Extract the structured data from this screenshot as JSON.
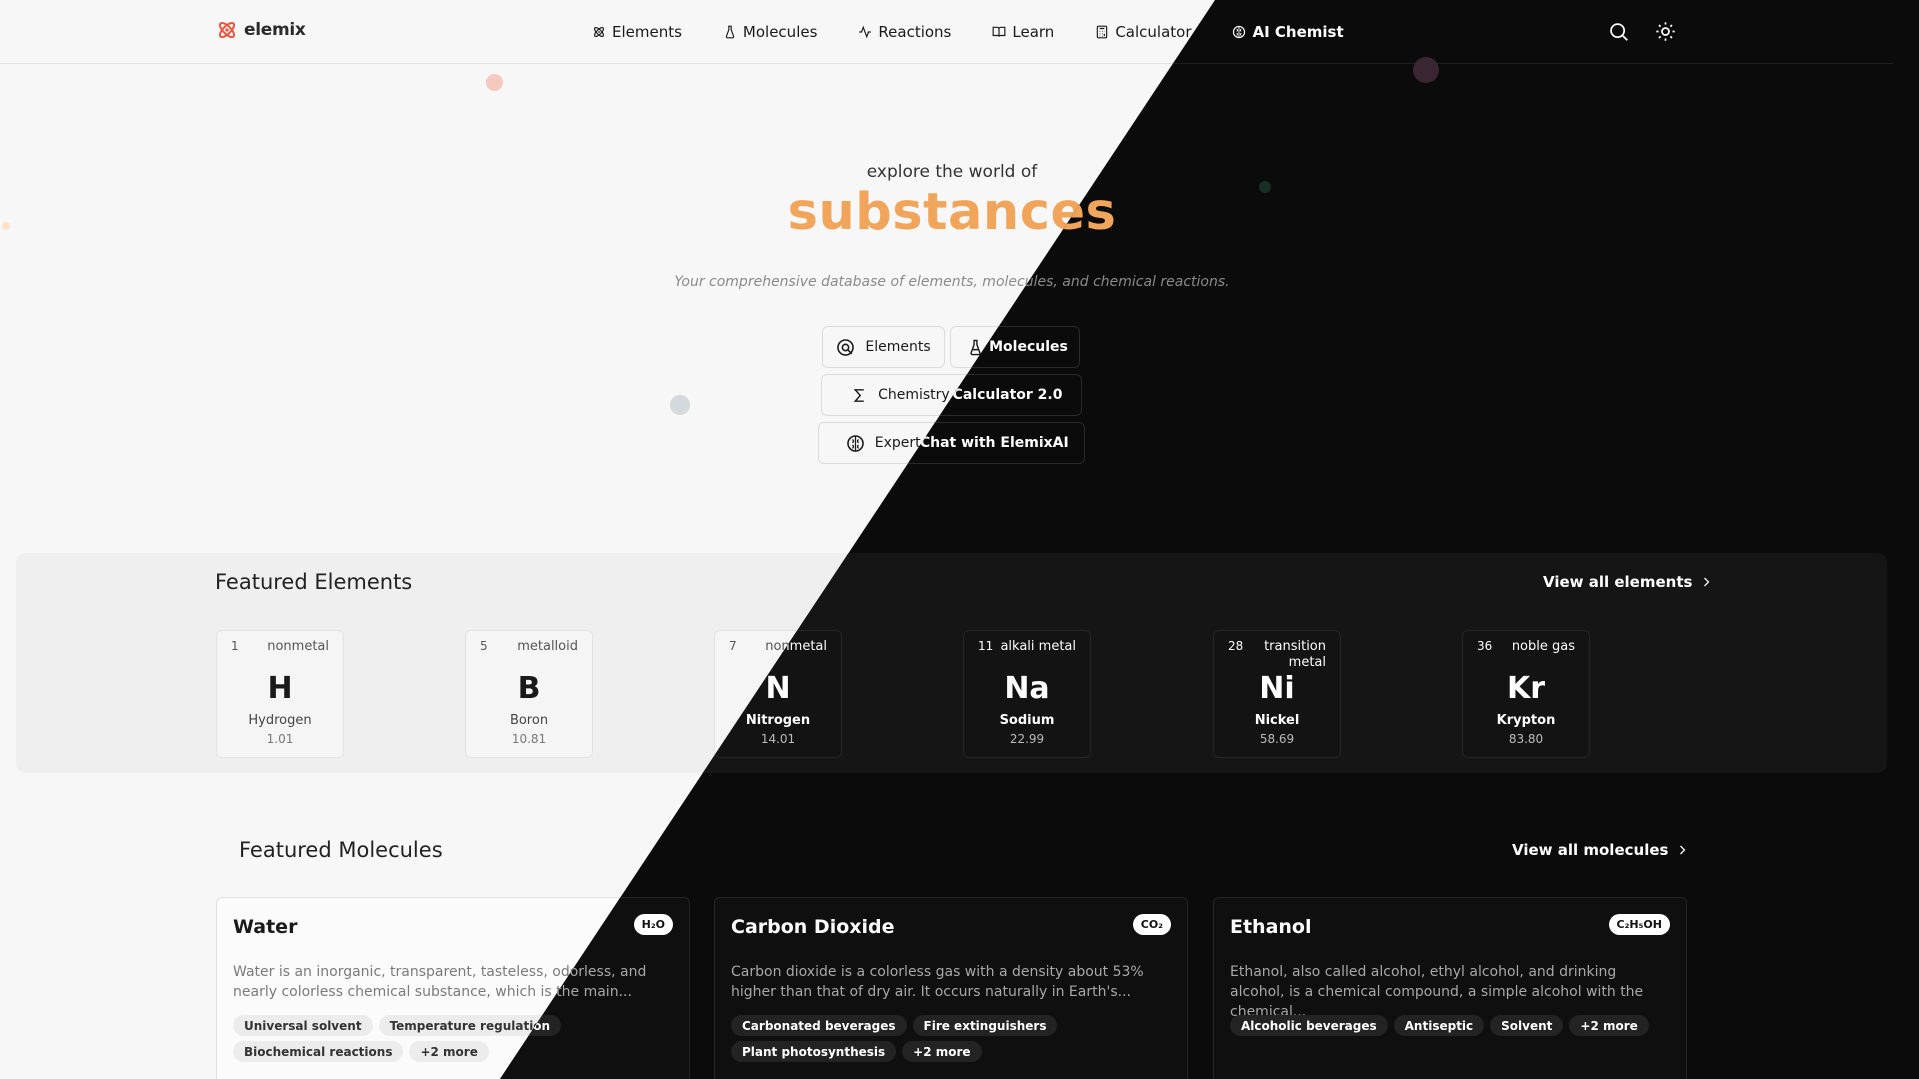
{
  "brand": {
    "name": "elemix"
  },
  "nav": {
    "links": [
      {
        "label": "Elements",
        "icon": "atom-icon"
      },
      {
        "label": "Molecules",
        "icon": "flask-icon"
      },
      {
        "label": "Reactions",
        "icon": "activity-icon"
      },
      {
        "label": "Learn",
        "icon": "book-icon"
      },
      {
        "label": "Calculator",
        "icon": "calculator-icon"
      },
      {
        "label": "AI Chemist",
        "icon": "brain-icon"
      }
    ],
    "tools": [
      "search-icon",
      "sun-icon"
    ]
  },
  "hero": {
    "kicker": "explore the world of",
    "title": "substances",
    "subtitle": "Your comprehensive database of elements, molecules, and chemical reactions.",
    "buttons": {
      "elements": "Elements",
      "molecules": "Molecules",
      "calculator": "Chemistry Calculator 2.0",
      "chat": "Expert Chat with ElemixAI"
    }
  },
  "featured_elements": {
    "title": "Featured Elements",
    "view_all": "View all elements",
    "items": [
      {
        "number": "1",
        "category": "nonmetal",
        "symbol": "H",
        "name": "Hydrogen",
        "mass": "1.01"
      },
      {
        "number": "5",
        "category": "metalloid",
        "symbol": "B",
        "name": "Boron",
        "mass": "10.81"
      },
      {
        "number": "7",
        "category": "nonmetal",
        "symbol": "N",
        "name": "Nitrogen",
        "mass": "14.01"
      },
      {
        "number": "11",
        "category": "alkali metal",
        "symbol": "Na",
        "name": "Sodium",
        "mass": "22.99"
      },
      {
        "number": "28",
        "category": "transition metal",
        "symbol": "Ni",
        "name": "Nickel",
        "mass": "58.69"
      },
      {
        "number": "36",
        "category": "noble gas",
        "symbol": "Kr",
        "name": "Krypton",
        "mass": "83.80"
      }
    ]
  },
  "featured_molecules": {
    "title": "Featured Molecules",
    "view_all": "View all molecules",
    "items": [
      {
        "name": "Water",
        "formula": "H₂O",
        "description": "Water is an inorganic, transparent, tasteless, odorless, and nearly colorless chemical substance, which is the main...",
        "tags": [
          "Universal solvent",
          "Temperature regulation",
          "Biochemical reactions",
          "+2 more"
        ]
      },
      {
        "name": "Carbon Dioxide",
        "formula": "CO₂",
        "description": "Carbon dioxide is a colorless gas with a density about 53% higher than that of dry air. It occurs naturally in Earth's...",
        "tags": [
          "Carbonated beverages",
          "Fire extinguishers",
          "Plant photosynthesis",
          "+2 more"
        ]
      },
      {
        "name": "Ethanol",
        "formula": "C₂H₅OH",
        "description": "Ethanol, also called alcohol, ethyl alcohol, and drinking alcohol, is a chemical compound, a simple alcohol with the chemical...",
        "tags": [
          "Alcoholic beverages",
          "Antiseptic",
          "Solvent",
          "+2 more"
        ]
      }
    ]
  },
  "colors": {
    "accent": "#f0a55b",
    "light_bg": "#f7f7f7",
    "dark_bg": "#0b0b0b"
  }
}
